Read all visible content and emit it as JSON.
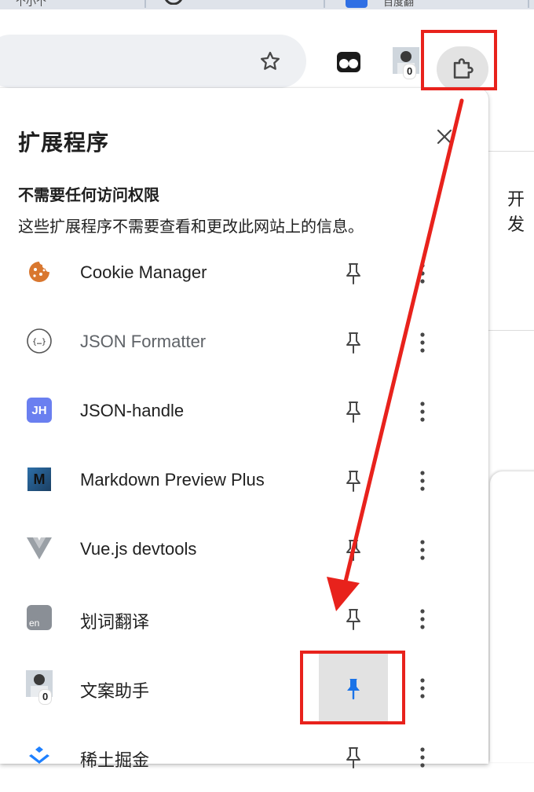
{
  "browser": {
    "tab_fragments": [
      "个小个",
      "",
      "百度翻"
    ],
    "toolbar_icons": [
      "bookmark-star-icon",
      "glasses-extension-icon",
      "avatar-extension-icon",
      "extensions-puzzle-icon"
    ],
    "avatar_badge": "0"
  },
  "page_behind": {
    "partial_text": "开发"
  },
  "popup": {
    "title": "扩展程序",
    "close_icon": "close-icon",
    "section_title": "不需要任何访问权限",
    "section_desc": "这些扩展程序不需要查看和更改此网站上的信息。",
    "extensions": [
      {
        "name": "Cookie Manager",
        "icon": "cookie-icon",
        "pinned": false,
        "dim": false
      },
      {
        "name": "JSON Formatter",
        "icon": "json-formatter-icon",
        "pinned": false,
        "dim": true
      },
      {
        "name": "JSON-handle",
        "icon": "jh-icon",
        "icon_text": "JH",
        "pinned": false,
        "dim": false
      },
      {
        "name": "Markdown Preview Plus",
        "icon": "markdown-icon",
        "icon_text": "M",
        "pinned": false,
        "dim": false
      },
      {
        "name": "Vue.js devtools",
        "icon": "vue-icon",
        "pinned": false,
        "dim": false
      },
      {
        "name": "划词翻译",
        "icon": "translate-icon",
        "icon_text": "en",
        "pinned": false,
        "dim": false
      },
      {
        "name": "文案助手",
        "icon": "avatar-icon",
        "badge": "0",
        "pinned": true,
        "dim": false
      },
      {
        "name": "稀土掘金",
        "icon": "juejin-icon",
        "pinned": false,
        "dim": false
      }
    ]
  },
  "colors": {
    "annotation_red": "#e8221c",
    "pin_active_blue": "#1a73e8",
    "icon_gray": "#474747"
  }
}
